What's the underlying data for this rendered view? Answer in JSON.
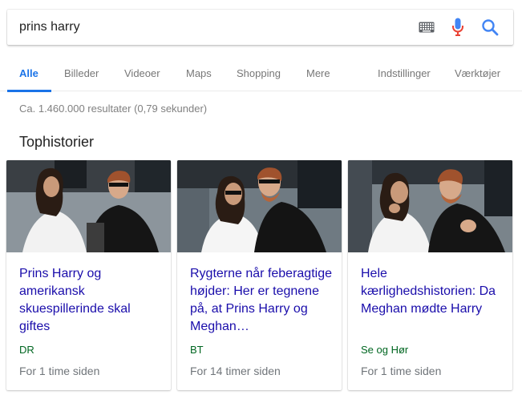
{
  "search": {
    "query": "prins harry"
  },
  "tabs": [
    {
      "label": "Alle",
      "active": true
    },
    {
      "label": "Billeder"
    },
    {
      "label": "Videoer"
    },
    {
      "label": "Maps"
    },
    {
      "label": "Shopping"
    },
    {
      "label": "Mere"
    },
    {
      "label": "Indstillinger"
    },
    {
      "label": "Værktøjer"
    }
  ],
  "results": {
    "stats": "Ca. 1.460.000 resultater (0,79 sekunder)"
  },
  "top_stories": {
    "title": "Tophistorier",
    "cards": [
      {
        "headline": "Prins Harry og amerikansk skuespillerinde skal giftes",
        "source": "DR",
        "time": "For 1 time siden"
      },
      {
        "headline": "Rygterne når feberagtige højder: Her er tegnene på, at Prins Harry og Meghan…",
        "source": "BT",
        "time": "For 14 timer siden"
      },
      {
        "headline": "Hele kærlighedshistorien: Da Meghan mødte Harry",
        "source": "Se og Hør",
        "time": "For 1 time siden"
      }
    ]
  },
  "colors": {
    "accent": "#1a73e8",
    "link": "#1a0dab",
    "source": "#006621",
    "mic_blue": "#4285f4",
    "mic_red": "#ea4335"
  },
  "icons": [
    "keyboard-icon",
    "microphone-icon",
    "search-icon"
  ]
}
